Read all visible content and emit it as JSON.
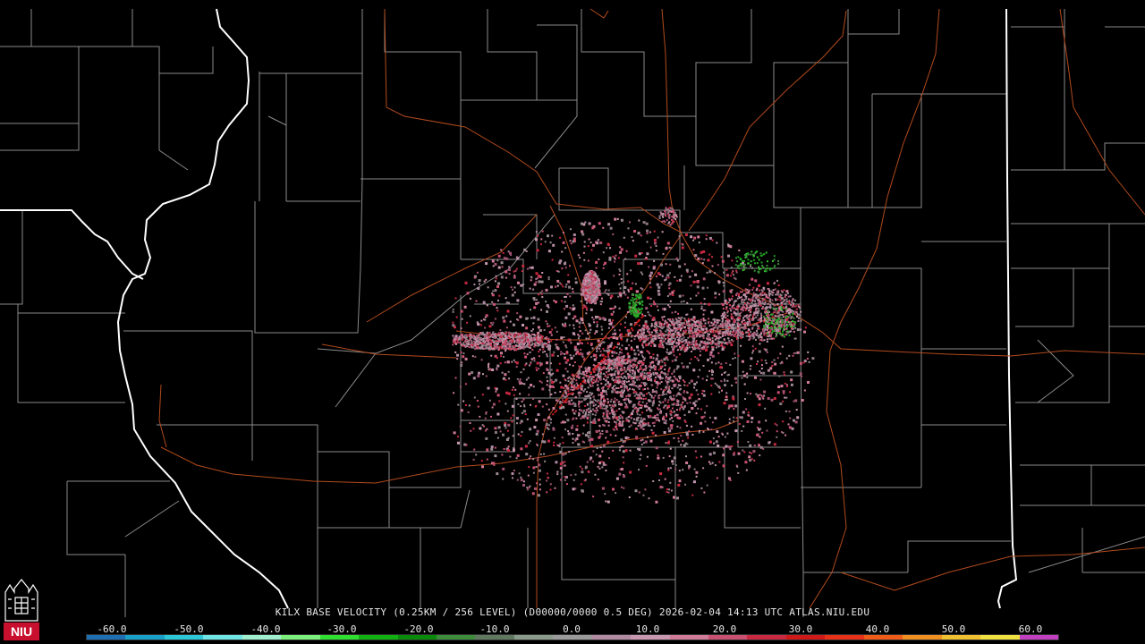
{
  "title": "KILX BASE VELOCITY (0.25KM / 256 LEVEL) (D00000/0000 0.5 DEG) 2026-02-04 14:13 UTC  ATLAS.NIU.EDU",
  "scale": {
    "ticks": [
      "-60.0",
      "-50.0",
      "-40.0",
      "-30.0",
      "-20.0",
      "-10.0",
      "0.0",
      "10.0",
      "20.0",
      "30.0",
      "40.0",
      "50.0",
      "60.0"
    ],
    "colors": [
      "#1e6eb4",
      "#18a0c8",
      "#2cc8d8",
      "#6ee6e6",
      "#a0f0d0",
      "#7cf07c",
      "#30e030",
      "#10b010",
      "#0a8a0a",
      "#3c8c3c",
      "#607860",
      "#8a9a8a",
      "#9a9a9a",
      "#b08aa0",
      "#c898b0",
      "#d07c98",
      "#c85070",
      "#c82840",
      "#d01818",
      "#e83018",
      "#f05c18",
      "#f09020",
      "#f0c030",
      "#f0e040",
      "#c040c0"
    ]
  },
  "logo": {
    "text": "NIU",
    "color": "#c8102e"
  }
}
